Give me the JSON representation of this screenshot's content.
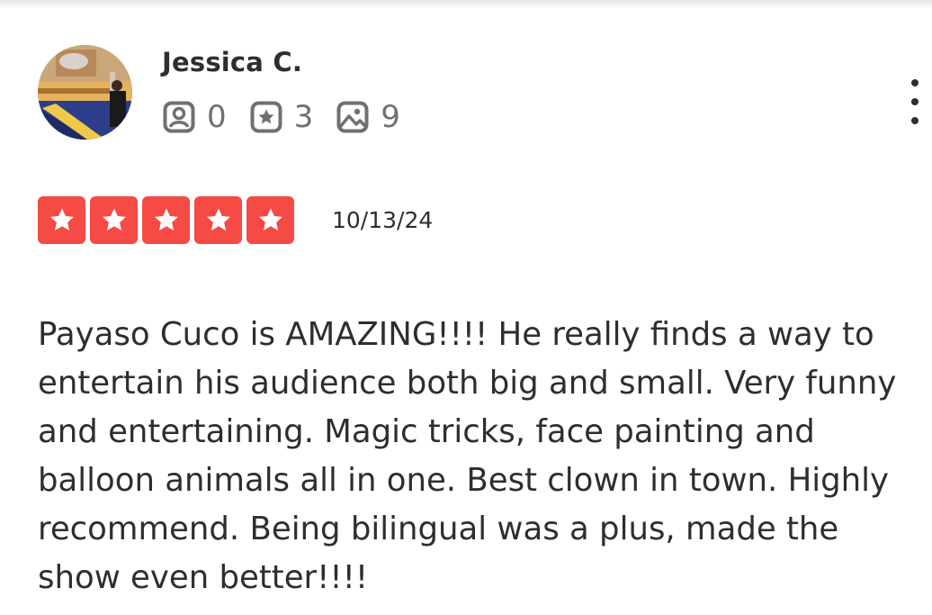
{
  "review": {
    "user": {
      "name": "Jessica C.",
      "avatar_icon": "user-avatar-photo",
      "stats": [
        {
          "icon": "friends-icon",
          "value": "0"
        },
        {
          "icon": "reviews-star-icon",
          "value": "3"
        },
        {
          "icon": "photos-icon",
          "value": "9"
        }
      ]
    },
    "more_icon": "more-vertical-icon",
    "rating": {
      "stars": 5,
      "max": 5,
      "color": "#f64a44"
    },
    "date": "10/13/24",
    "text": "Payaso Cuco is AMAZING!!!! He really finds a way to entertain his audience both big and small. Very funny and entertaining. Magic tricks, face painting and balloon animals all in one. Best clown in town. Highly recommend. Being bilingual was a plus, made the show even better!!!!"
  }
}
